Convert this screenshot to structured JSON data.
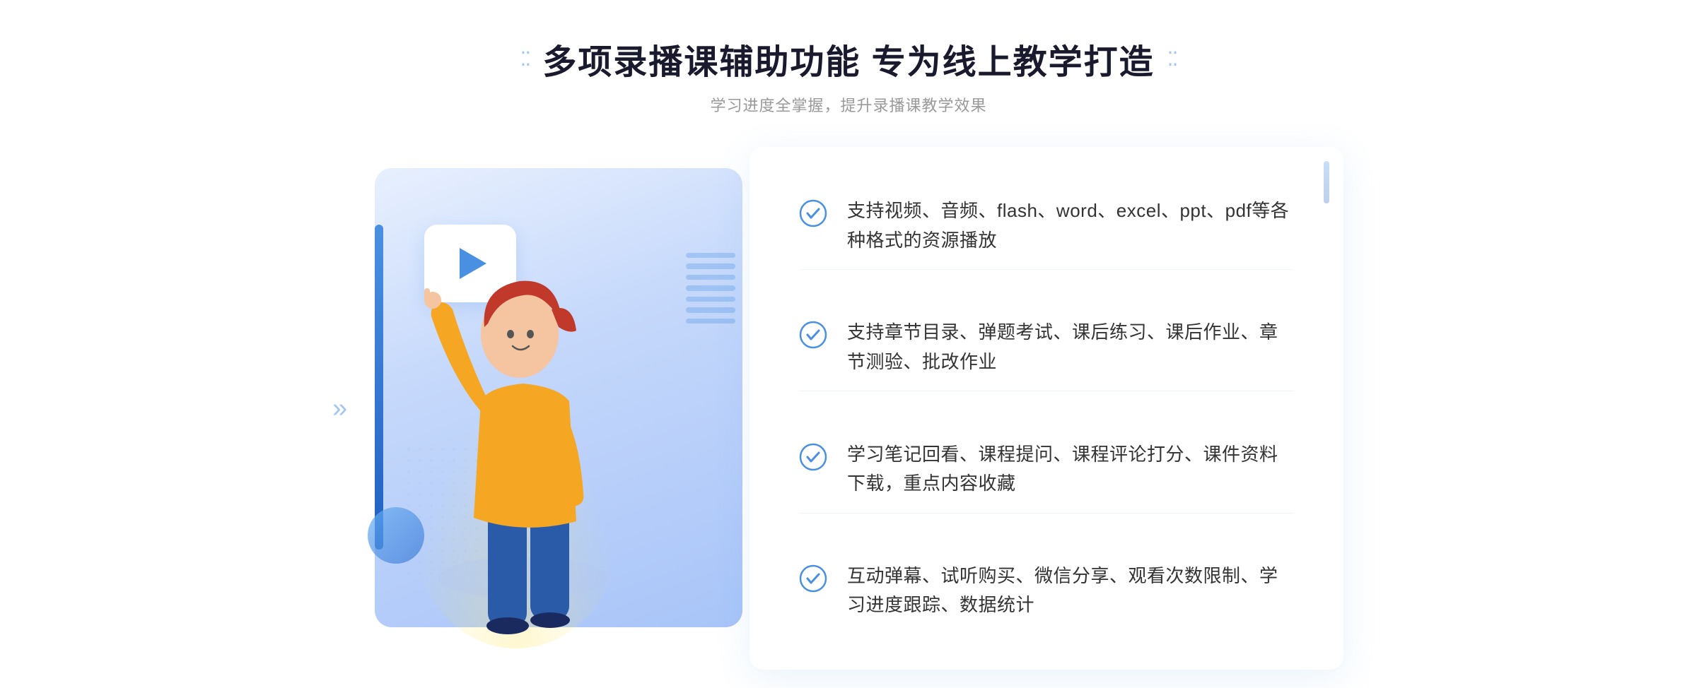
{
  "header": {
    "title": "多项录播课辅助功能 专为线上教学打造",
    "subtitle": "学习进度全掌握，提升录播课教学效果",
    "title_dots_left": "⁚⁚",
    "title_dots_right": "⁚⁚"
  },
  "features": [
    {
      "id": 1,
      "text": "支持视频、音频、flash、word、excel、ppt、pdf等各种格式的资源播放"
    },
    {
      "id": 2,
      "text": "支持章节目录、弹题考试、课后练习、课后作业、章节测验、批改作业"
    },
    {
      "id": 3,
      "text": "学习笔记回看、课程提问、课程评论打分、课件资料下载，重点内容收藏"
    },
    {
      "id": 4,
      "text": "互动弹幕、试听购买、微信分享、观看次数限制、学习进度跟踪、数据统计"
    }
  ],
  "colors": {
    "primary": "#4a90e2",
    "dark_blue": "#2060c0",
    "light_bg": "#e8f0fe",
    "text_dark": "#1a1a2e",
    "text_medium": "#333333",
    "text_light": "#999999"
  },
  "chevrons_left": "»",
  "play_icon": "▶"
}
